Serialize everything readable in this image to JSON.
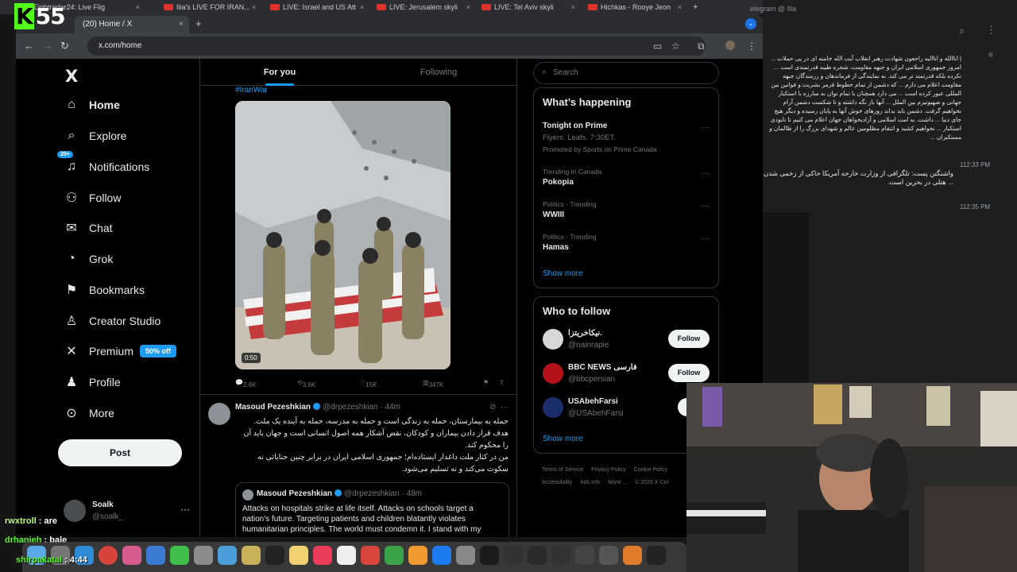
{
  "top_tabs": [
    {
      "label": "Eightradar24: Live Flig"
    },
    {
      "label": "Ilia's LIVE FOR IRAN..."
    },
    {
      "label": "LIVE: Israel and US Att"
    },
    {
      "label": "LIVE: Jerusalem skyli"
    },
    {
      "label": "LIVE: Tel Aviv skyli"
    },
    {
      "label": "Hichkas - Rooye Jeon"
    }
  ],
  "overlay": {
    "counter": "55",
    "k": "K"
  },
  "browser": {
    "tab_title": "(20) Home / X",
    "url": "x.com/home"
  },
  "nav": {
    "logo": "X",
    "items": [
      {
        "label": "Home",
        "icon": "home-icon"
      },
      {
        "label": "Explore",
        "icon": "search-icon"
      },
      {
        "label": "Notifications",
        "icon": "bell-icon",
        "badge": "20+"
      },
      {
        "label": "Follow",
        "icon": "add-user-icon"
      },
      {
        "label": "Chat",
        "icon": "mail-icon"
      },
      {
        "label": "Grok",
        "icon": "grok-icon"
      },
      {
        "label": "Bookmarks",
        "icon": "bookmark-icon"
      },
      {
        "label": "Creator Studio",
        "icon": "creator-studio-icon"
      },
      {
        "label": "Premium",
        "icon": "x-icon",
        "badge": "50% off"
      },
      {
        "label": "Profile",
        "icon": "person-icon"
      },
      {
        "label": "More",
        "icon": "more-circle-icon"
      }
    ],
    "post_label": "Post",
    "account": {
      "name": "Soalk",
      "handle": "@soalk_"
    }
  },
  "feed": {
    "tabs": [
      "For you",
      "Following"
    ],
    "hashtag": "#IranWar",
    "video_duration": "0:50",
    "actions1": {
      "replies": "2.8K",
      "reposts": "3.6K",
      "likes": "15K",
      "views": "347K"
    },
    "tweet2": {
      "name": "Masoud Pezeshkian",
      "handle": "@drpezeshkian",
      "time": "· 44m",
      "body_lines": [
        "حمله به بیمارستان، حمله به زندگی است و حمله به مدرسه، حمله به آینده یک ملت.",
        "هدف قرار دادن بیماران و کودکان، نقض آشکار همه اصول انسانی است و جهان باید آن را محکوم کند.",
        "من در کنار ملت داغدار ایستاده‌ام؛ جمهوری اسلامی ایران در برابر چنین جنایاتی نه سکوت می‌کند و نه تسلیم می‌شود."
      ],
      "quote": {
        "name": "Masoud Pezeshkian",
        "handle": "@drpezeshkian",
        "time": "· 48m",
        "body": "Attacks on hospitals strike at life itself. Attacks on schools target a nation's future. Targeting patients and children blatantly violates humanitarian principles. The world must condemn it. I stand with my"
      }
    }
  },
  "right": {
    "search_placeholder": "Search",
    "happening_title": "What’s happening",
    "trends": [
      {
        "context": "",
        "title": "Tonight on Prime",
        "sub": "Flyers. Leafs. 7:30ET.",
        "promo": "Promoted by Sports on Prime Canada"
      },
      {
        "context": "Trending in Canada",
        "title": "Pokopia"
      },
      {
        "context": "Politics · Trending",
        "title": "WWIII"
      },
      {
        "context": "Politics · Trending",
        "title": "Hamas"
      }
    ],
    "show_more": "Show more",
    "who_title": "Who to follow",
    "who": [
      {
        "name": "نیکاخریتزا.",
        "handle": "@nainrapie",
        "button": "Follow"
      },
      {
        "name": "BBC NEWS فارسی",
        "handle": "@bbcpersian",
        "button": "Follow"
      },
      {
        "name": "USAbehFarsi",
        "handle": "@USAbehFarsi",
        "button": "Fo"
      }
    ],
    "show_more2": "Show more",
    "footer": [
      "Terms of Service",
      "Privacy Policy",
      "Cookie Policy",
      "Accessibility",
      "Ads info",
      "More ...",
      "© 2026 X Cor"
    ]
  },
  "telegram": {
    "title": "elegram @ Ilia",
    "msg1": "| اناالله و اناالیه راجعون شهادت رهبر انقلاب آیت الله خامنه ای در پی حملات ... امروز جمهوری اسلامی ایران و جبهه مقاومت، شجره طیبه قدرتمندی است ... نکرده بلکه قدرتمند تر می کند. به نمایندگی از فرماندهان و رزمندگان جبهه مقاومت اعلام می دارم ... که دشمن از تمام خطوط قرمز بشریت و قوانین بین المللی عبور کرده است ... می دارد همچنان با تمام توان به مبارزه با استکبار جهانی و صهیونیزم بین الملل ... آنها باز نگه داشته و تا شکست دشمن آرام نخواهیم گرفت. دشمن باید بداند روزهای خوش آنها به پایان رسیده و دیگر هیچ جای دنیا ... داشت. به امت اسلامی و آزادیخواهان جهان اعلام می کنیم تا نابودی استکبار ... نخواهیم کشید و انتقام مظلومین عالم و شهدای بزرگ را از ظالمان و مستکبران ...",
    "time1": "112:33 PM",
    "msg2": "واشنگتن پست: تلگرافی از وزارت خارجه آمریکا حاکی از زخمی شدن ... هتلی در بحرین است.",
    "time2": "112:35 PM"
  },
  "chat": [
    {
      "user": "rwxtroll",
      "msg": ": are"
    },
    {
      "user": "drhanieh",
      "msg": ": bale"
    },
    {
      "user": "shirpakatal",
      "msg": ": 4:44"
    }
  ],
  "colors": {
    "accent": "#1d9bf0",
    "bg": "#000000",
    "border": "#2f3336",
    "muted": "#71767b",
    "kick": "#53fc18"
  }
}
